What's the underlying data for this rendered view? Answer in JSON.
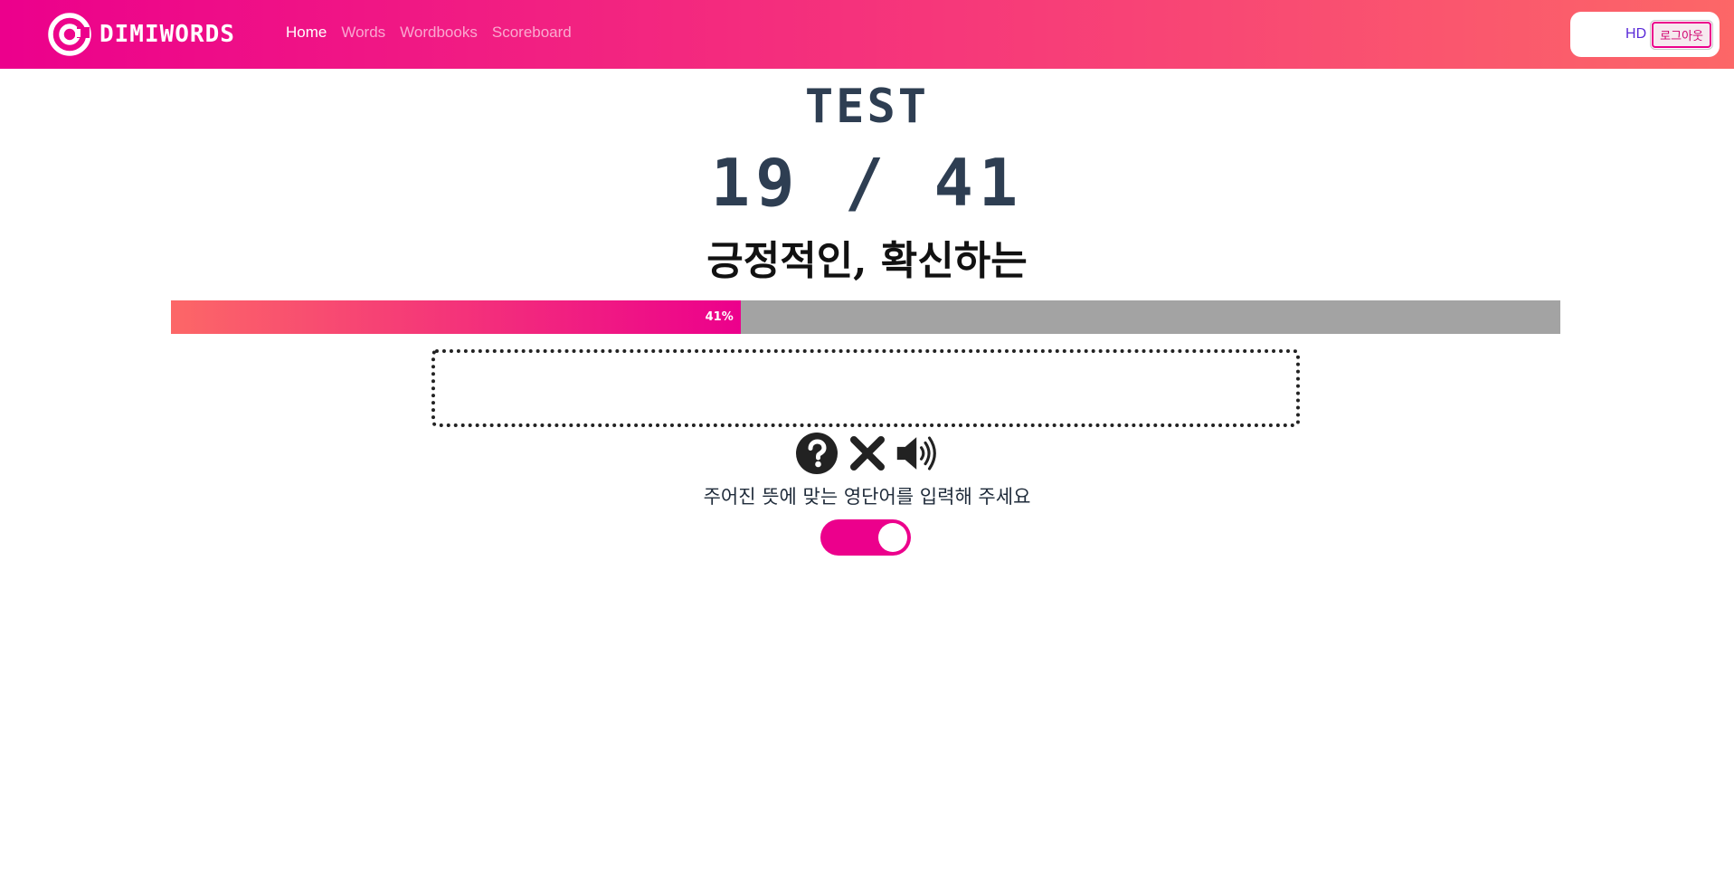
{
  "navbar": {
    "brand": "DIMIWORDS",
    "links": [
      {
        "label": "Home",
        "active": true
      },
      {
        "label": "Words",
        "active": false
      },
      {
        "label": "Wordbooks",
        "active": false
      },
      {
        "label": "Scoreboard",
        "active": false
      }
    ],
    "user_initials": "HD",
    "logout_label": "로그아웃"
  },
  "quiz": {
    "title": "TEST",
    "current": "19",
    "separator": "/",
    "total": "41",
    "meaning": "긍정적인, 확신하는",
    "progress_percent": 41,
    "progress_label": "41%",
    "answer_value": "",
    "instruction": "주어진 뜻에 맞는 영단어를 입력해 주세요",
    "toggle_on": true
  },
  "icons": {
    "logo": "dimigo-logo-icon",
    "hint": "question-circle-icon",
    "skip": "close-icon",
    "speak": "speaker-icon"
  },
  "colors": {
    "brand_pink": "#ec008c",
    "brand_coral": "#fc6767",
    "text_navy": "#2e3e52",
    "progress_track": "#a3a3a3"
  }
}
